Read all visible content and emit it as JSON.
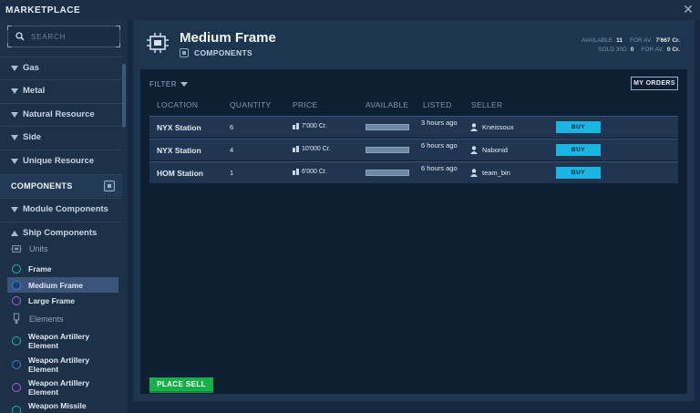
{
  "window": {
    "title": "MARKETPLACE"
  },
  "search": {
    "placeholder": "SEARCH"
  },
  "sidebar": {
    "categories": [
      {
        "label": "Gas"
      },
      {
        "label": "Metal"
      },
      {
        "label": "Natural Resource"
      },
      {
        "label": "Side"
      },
      {
        "label": "Unique Resource"
      }
    ],
    "components_label": "COMPONENTS",
    "module_components": "Module Components",
    "ship_components": "Ship Components",
    "units_label": "Units",
    "units": [
      {
        "label": "Frame",
        "color": "#1fb8a8"
      },
      {
        "label": "Medium Frame",
        "color": "#3d7bd9"
      },
      {
        "label": "Large Frame",
        "color": "#b05ad8"
      }
    ],
    "elements_label": "Elements",
    "elements": [
      {
        "label": "Weapon Artillery Element",
        "color": "#1fb8a8"
      },
      {
        "label": "Weapon Artillery Element",
        "color": "#3d7bd9"
      },
      {
        "label": "Weapon Artillery Element",
        "color": "#b05ad8"
      },
      {
        "label": "Weapon Missile",
        "color": "#1fb8a8"
      }
    ]
  },
  "header": {
    "title": "Medium Frame",
    "subtitle": "COMPONENTS",
    "stats": {
      "available_label": "AVAILABLE",
      "available_value": "11",
      "for_av_label_1": "FOR AV.",
      "for_av_value_1": "7'667 Cr.",
      "sold_label": "SOLD 30D",
      "sold_value": "0",
      "for_av_label_2": "FOR AV.",
      "for_av_value_2": "0 Cr."
    }
  },
  "toolbar": {
    "filter_label": "FILTER",
    "my_orders_label": "MY ORDERS"
  },
  "table": {
    "columns": [
      "LOCATION",
      "QUANTITY",
      "PRICE",
      "AVAILABLE",
      "LISTED",
      "SELLER"
    ],
    "rows": [
      {
        "location": "NYX Station",
        "quantity": "6",
        "price": "7'000 Cr.",
        "available": 1.0,
        "listed": "3 hours ago",
        "seller": "Kneissoux",
        "buy": "BUY"
      },
      {
        "location": "NYX Station",
        "quantity": "4",
        "price": "10'000 Cr.",
        "available": 1.0,
        "listed": "6 hours ago",
        "seller": "Nabonid",
        "buy": "BUY"
      },
      {
        "location": "HOM Station",
        "quantity": "1",
        "price": "6'000 Cr.",
        "available": 1.0,
        "listed": "6 hours ago",
        "seller": "team_bin",
        "buy": "BUY"
      }
    ]
  },
  "footer": {
    "place_sell_label": "PLACE SELL"
  }
}
